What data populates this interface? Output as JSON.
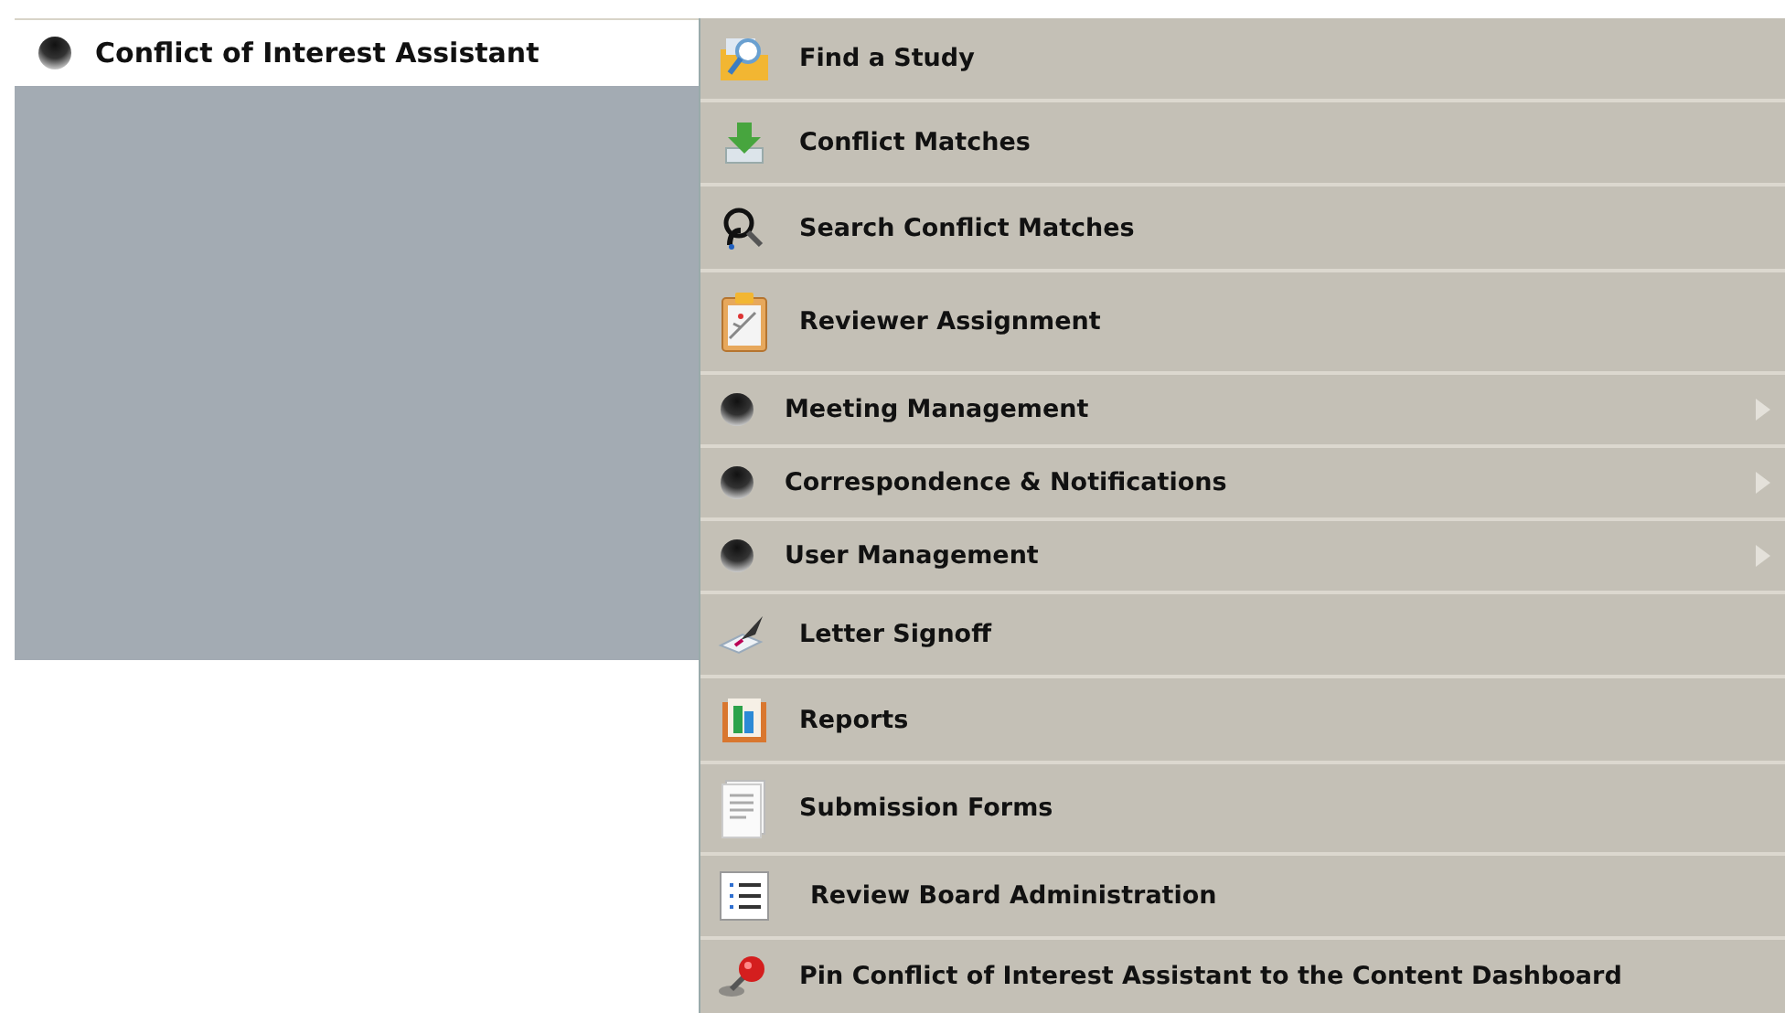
{
  "header": {
    "label": "Conflict of Interest Assistant"
  },
  "menu": [
    {
      "label": "Find a Study",
      "kind": "link"
    },
    {
      "label": "Conflict Matches",
      "kind": "link"
    },
    {
      "label": "Search Conflict Matches",
      "kind": "link"
    },
    {
      "label": "Reviewer Assignment",
      "kind": "link"
    },
    {
      "label": "Meeting Management",
      "kind": "submenu"
    },
    {
      "label": "Correspondence & Notifications",
      "kind": "submenu"
    },
    {
      "label": "User Management",
      "kind": "submenu"
    },
    {
      "label": "Letter Signoff",
      "kind": "link"
    },
    {
      "label": "Reports",
      "kind": "link"
    },
    {
      "label": "Submission Forms",
      "kind": "link"
    },
    {
      "label": "Review Board Administration",
      "kind": "link"
    },
    {
      "label": "Pin Conflict of Interest Assistant to the Content Dashboard",
      "kind": "link"
    }
  ]
}
